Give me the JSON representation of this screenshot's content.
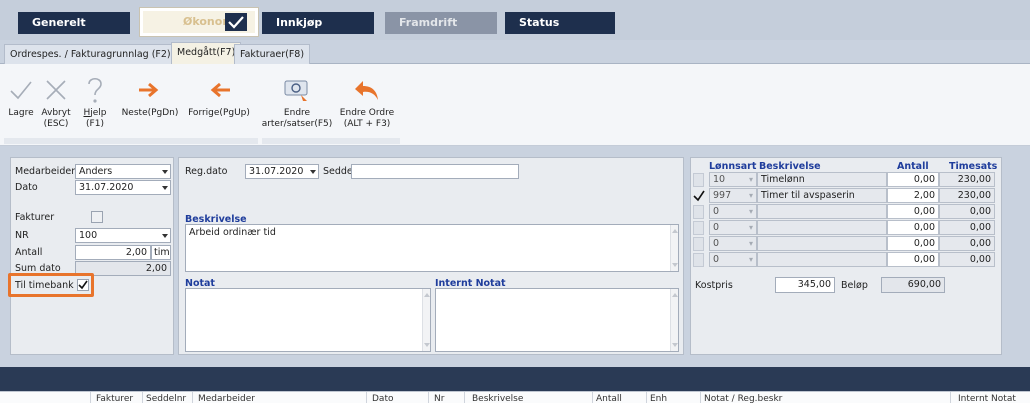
{
  "nav": {
    "generelt": "Generelt",
    "okonomi": "Økonomi",
    "innkjop": "Innkjøp",
    "framdrift": "Framdrift",
    "status": "Status"
  },
  "tabs": {
    "ordrespes": "Ordrespes. / Fakturagrunnlag (F2)",
    "medgatt": "Medgått(F7)",
    "fakturaer": "Fakturaer(F8)"
  },
  "ribbon": {
    "lagre": "Lagre",
    "avbryt_1": "Avbryt",
    "avbryt_2": "(ESC)",
    "hjelp_u": "H",
    "hjelp_rest": "jelp",
    "hjelp_2": "(F1)",
    "neste": "Neste(PgDn)",
    "forrige": "Forrige(PgUp)",
    "endre_arter_1": "Endre",
    "endre_arter_2": "arter/satser(F5)",
    "endre_ordre_1": "Endre Ordre",
    "endre_ordre_2": "(ALT + F3)"
  },
  "left": {
    "medarbeider_label": "Medarbeider",
    "medarbeider_value": "Anders",
    "dato_label": "Dato",
    "dato_value": "31.07.2020",
    "fakturer_label": "Fakturer",
    "nr_label": "NR",
    "nr_value": "100",
    "antall_label": "Antall",
    "antall_value": "2,00",
    "antall_unit": "tim",
    "sum_dato_label": "Sum dato",
    "sum_dato_value": "2,00",
    "til_timebank_label": "Til timebank"
  },
  "middle": {
    "reg_dato_label": "Reg.dato",
    "reg_dato_value": "31.07.2020",
    "seddel_label": "Seddel:",
    "beskrivelse_label": "Beskrivelse",
    "beskrivelse_value": "Arbeid ordinær tid",
    "notat_label": "Notat",
    "internt_notat_label": "Internt Notat"
  },
  "right": {
    "headers": {
      "lonnsart": "Lønnsart",
      "beskrivelse": "Beskrivelse",
      "antall": "Antall",
      "timesats": "Timesats"
    },
    "rows": [
      {
        "code": "10",
        "desc": "Timelønn",
        "antall": "0,00",
        "sats": "230,00",
        "checked": false
      },
      {
        "code": "997",
        "desc": "Timer til avspaserin",
        "antall": "2,00",
        "sats": "230,00",
        "checked": true
      },
      {
        "code": "0",
        "desc": "",
        "antall": "0,00",
        "sats": "0,00",
        "checked": false
      },
      {
        "code": "0",
        "desc": "",
        "antall": "0,00",
        "sats": "0,00",
        "checked": false
      },
      {
        "code": "0",
        "desc": "",
        "antall": "0,00",
        "sats": "0,00",
        "checked": false
      },
      {
        "code": "0",
        "desc": "",
        "antall": "0,00",
        "sats": "0,00",
        "checked": false
      }
    ],
    "kostpris_label": "Kostpris",
    "kostpris_value": "345,00",
    "belop_label": "Beløp",
    "belop_value": "690,00"
  },
  "grid_columns": {
    "fakturer": "Fakturer",
    "seddelnr": "Seddelnr",
    "medarbeider": "Medarbeider",
    "dato": "Dato",
    "nr": "Nr",
    "beskrivelse": "Beskrivelse",
    "antall": "Antall",
    "enh": "Enh",
    "notat": "Notat / Reg.beskr",
    "internt_notat": "Internt Notat"
  },
  "colors": {
    "nav_dark": "#1e2f4d",
    "highlight_orange": "#e8742c",
    "label_blue": "#1f3d9c",
    "arrow_orange": "#e8742c"
  }
}
